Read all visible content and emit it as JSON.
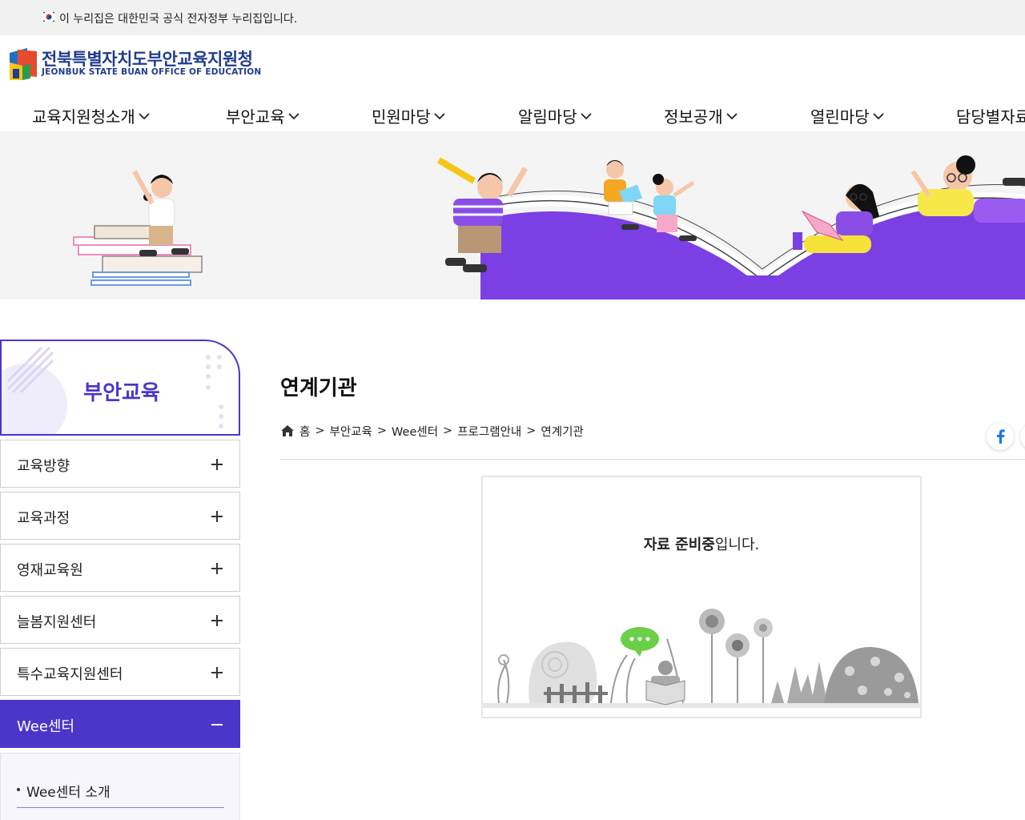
{
  "gov_banner": {
    "text": "이 누리집은 대한민국 공식 전자정부 누리집입니다."
  },
  "logo": {
    "title": "전북특별자치도부안교육지원청",
    "subtitle": "JEONBUK STATE BUAN OFFICE OF EDUCATION"
  },
  "nav": {
    "items": [
      {
        "label": "교육지원청소개"
      },
      {
        "label": "부안교육"
      },
      {
        "label": "민원마당"
      },
      {
        "label": "알림마당"
      },
      {
        "label": "정보공개"
      },
      {
        "label": "열린마당"
      },
      {
        "label": "담당별자료"
      }
    ]
  },
  "sidebar": {
    "title": "부안교육",
    "items": [
      {
        "label": "교육방향"
      },
      {
        "label": "교육과정"
      },
      {
        "label": "영재교육원"
      },
      {
        "label": "늘봄지원센터"
      },
      {
        "label": "특수교육지원센터"
      },
      {
        "label": "Wee센터"
      }
    ],
    "sub_items": [
      {
        "label": "Wee센터 소개"
      }
    ]
  },
  "content": {
    "page_title": "연계기관",
    "breadcrumb": [
      "홈",
      "부안교육",
      "Wee센터",
      "프로그램안내",
      "연계기관"
    ],
    "breadcrumb_sep": ">",
    "notice_bold": "자료 준비중",
    "notice_rest": "입니다."
  },
  "colors": {
    "accent": "#4a36c9",
    "logo_blue": "#1f3c8f",
    "hero_purple": "#7b3fe4"
  }
}
